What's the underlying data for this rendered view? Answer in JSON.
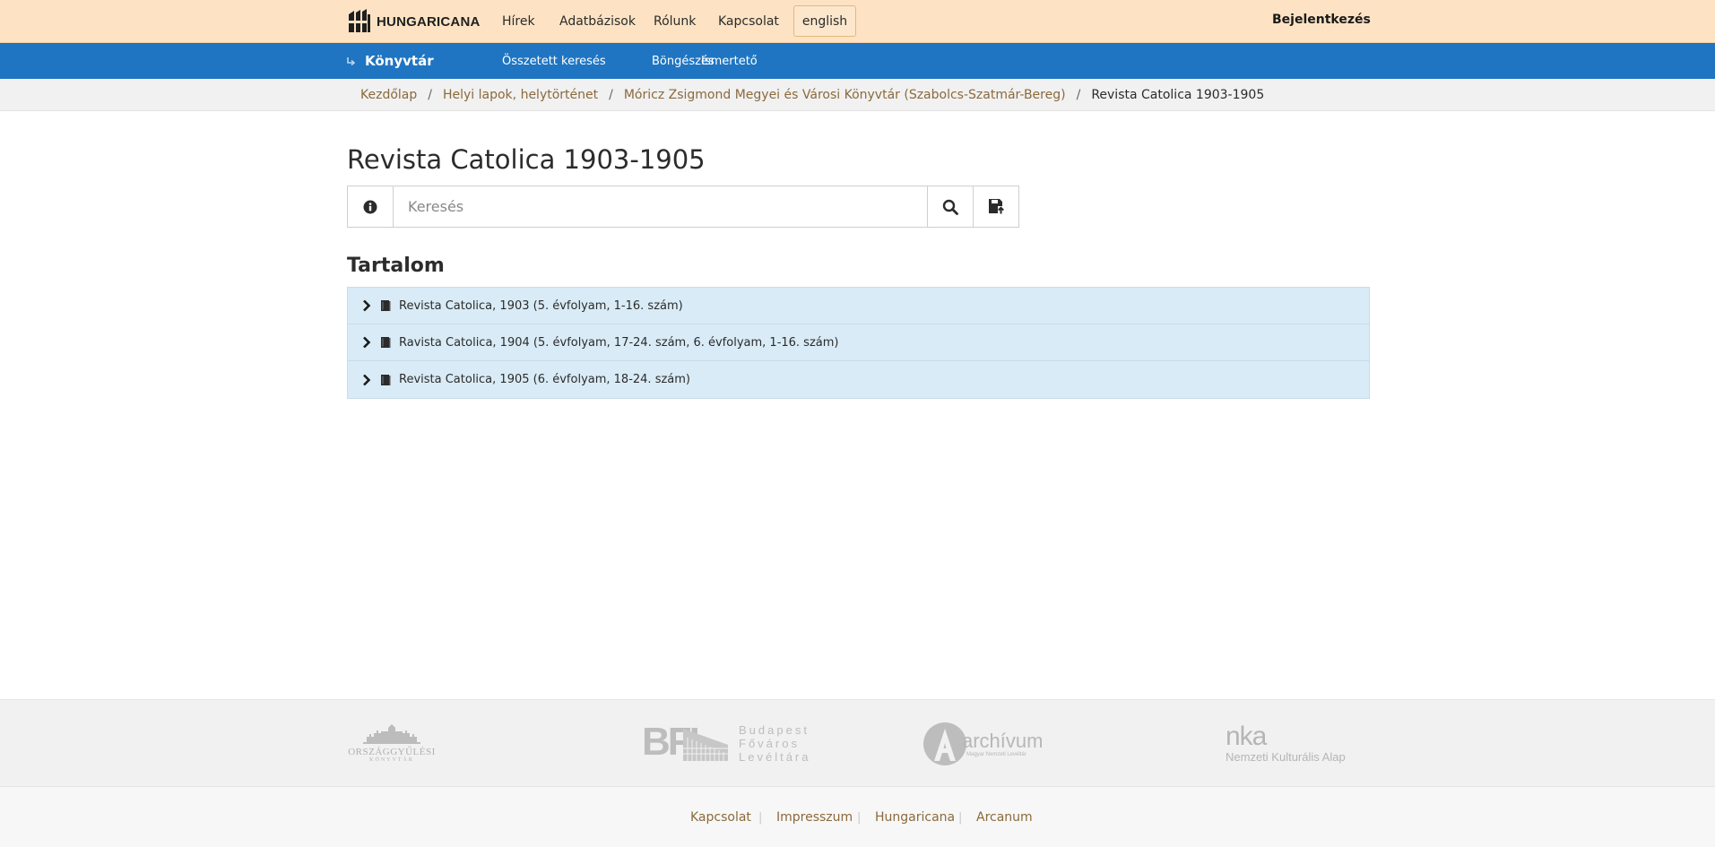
{
  "header": {
    "brand": "HUNGARICANA",
    "nav": [
      "Hírek",
      "Adatbázisok",
      "Rólunk",
      "Kapcsolat"
    ],
    "language_button": "english",
    "login": "Bejelentkezés"
  },
  "library_bar": {
    "title": "Könyvtár",
    "nav": [
      "Összetett keresés",
      "Böngészés",
      "Ismertető"
    ]
  },
  "breadcrumb": {
    "items": [
      "Kezdőlap",
      "Helyi lapok, helytörténet",
      "Móricz Zsigmond Megyei és Városi Könyvtár (Szabolcs-Szatmár-Bereg)"
    ],
    "current": "Revista Catolica 1903-1905",
    "separator": "/"
  },
  "main": {
    "title": "Revista Catolica 1903-1905",
    "search": {
      "placeholder": "Keresés",
      "value": ""
    },
    "contents_title": "Tartalom",
    "contents": [
      "Revista Catolica, 1903 (5. évfolyam, 1-16. szám)",
      "Ravista Catolica, 1904 (5. évfolyam, 17-24. szám, 6. évfolyam, 1-16. szám)",
      "Revista Catolica, 1905 (6. évfolyam, 18-24. szám)"
    ]
  },
  "footer": {
    "logos": {
      "parliament": [
        "ORSZÁGGYŰLÉSI",
        "KÖNYVTÁR"
      ],
      "bfl": [
        "BFL",
        "Budapest",
        "Főváros",
        "Levéltára"
      ],
      "archivum": [
        "archívum",
        "Magyar Nemzeti Levéltár"
      ],
      "nka": [
        "nka",
        "Nemzeti Kulturális Alap"
      ]
    },
    "links": [
      "Kapcsolat",
      "Impresszum",
      "Hungaricana",
      "Arcanum"
    ],
    "separator": "|"
  },
  "colors": {
    "topbar": "#fde3c3",
    "bluebar": "#1f75c1",
    "tree_bg": "#d9ebf6",
    "link_brown": "#8a6a3c"
  },
  "icons": [
    "hungaricana-logo",
    "arrow-icon",
    "info-icon",
    "search-icon",
    "save-search-icon",
    "chevron-right-icon",
    "book-icon"
  ]
}
